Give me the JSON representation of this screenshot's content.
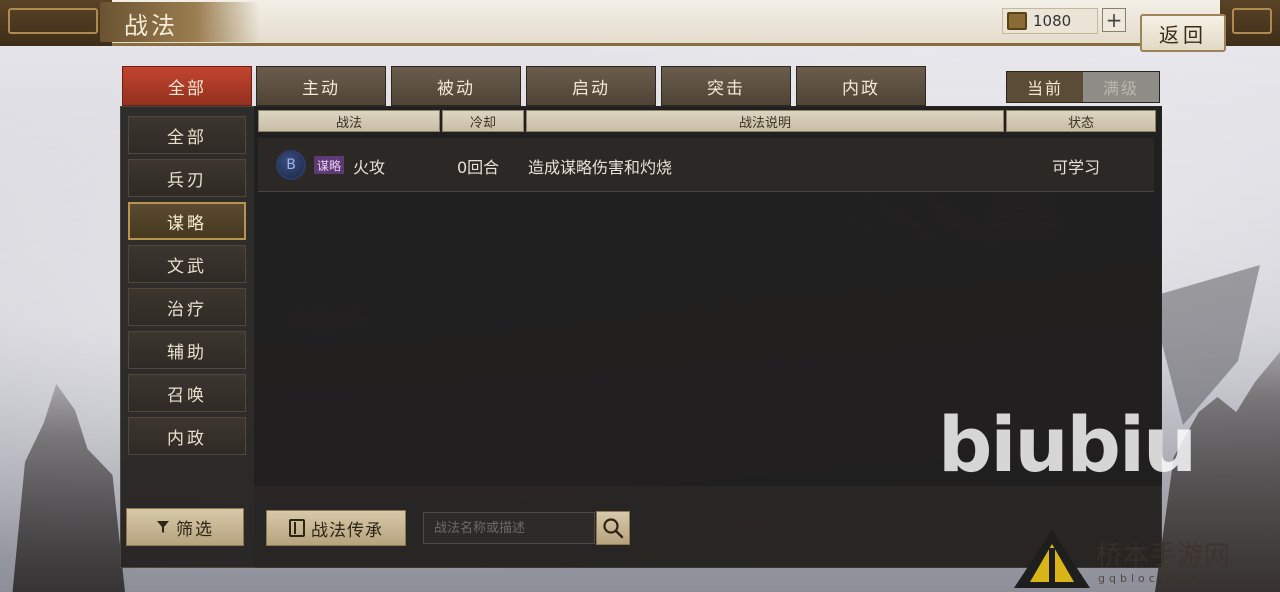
{
  "header": {
    "title": "战法",
    "currency_value": "1080",
    "add_label": "+",
    "back_label": "返回"
  },
  "tabs": [
    {
      "label": "全部",
      "active": true
    },
    {
      "label": "主动",
      "active": false
    },
    {
      "label": "被动",
      "active": false
    },
    {
      "label": "启动",
      "active": false
    },
    {
      "label": "突击",
      "active": false
    },
    {
      "label": "内政",
      "active": false
    }
  ],
  "level_toggle": {
    "current_label": "当前",
    "max_label": "满级"
  },
  "sidebar": {
    "items": [
      {
        "label": "全部",
        "active": false
      },
      {
        "label": "兵刃",
        "active": false
      },
      {
        "label": "谋略",
        "active": true
      },
      {
        "label": "文武",
        "active": false
      },
      {
        "label": "治疗",
        "active": false
      },
      {
        "label": "辅助",
        "active": false
      },
      {
        "label": "召唤",
        "active": false
      },
      {
        "label": "内政",
        "active": false
      }
    ],
    "filter_label": "筛选"
  },
  "table": {
    "columns": [
      "战法",
      "冷却",
      "战法说明",
      "状态"
    ],
    "rows": [
      {
        "grade": "B",
        "type_tag": "谋略",
        "name": "火攻",
        "cooldown": "0回合",
        "description": "造成谋略伤害和灼烧",
        "status": "可学习"
      }
    ]
  },
  "bottom": {
    "inherit_label": "战法传承",
    "search_placeholder": "战法名称或描述"
  },
  "watermarks": {
    "brand": "biubiu",
    "site_name": "桥本手游网",
    "site_url": "gqbloc.com"
  },
  "colors": {
    "active_tab": "#c2452f",
    "accent_gold": "#b8944f",
    "grade_b": "#2c3c66",
    "tag_purple": "#5d3a74"
  },
  "icons": [
    "coin-icon",
    "plus-icon",
    "filter-icon",
    "book-icon",
    "search-icon"
  ]
}
